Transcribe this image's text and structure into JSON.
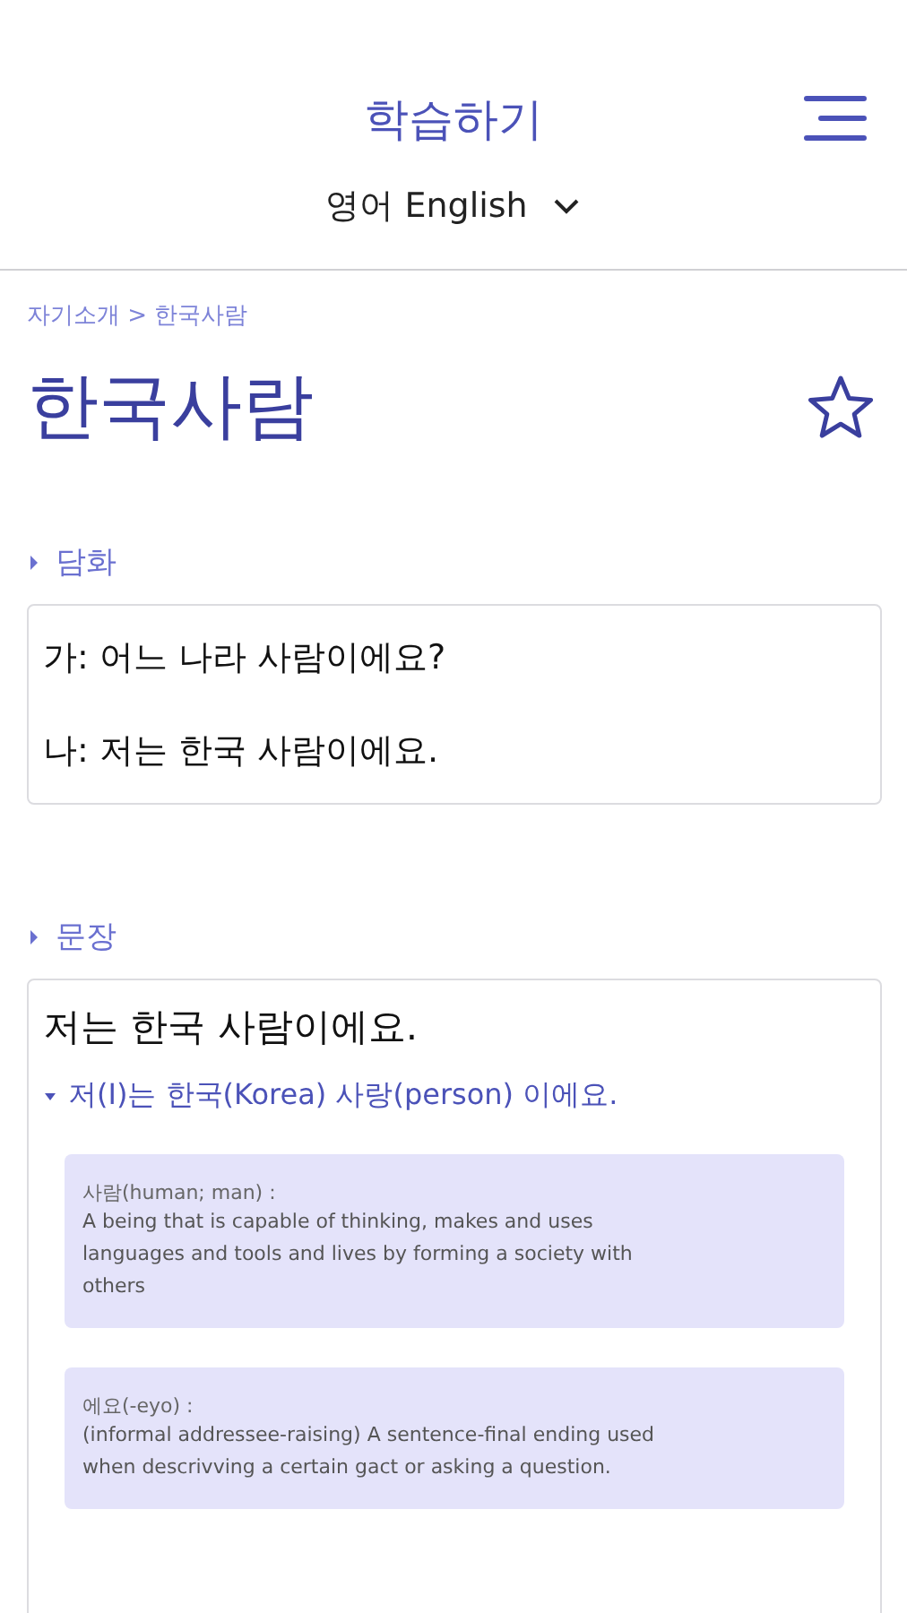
{
  "header": {
    "title": "학습하기",
    "language": "영어 English"
  },
  "breadcrumb": "자기소개 > 한국사람",
  "page": {
    "title": "한국사람",
    "favorite": false
  },
  "sections": [
    {
      "kind": "dialogue",
      "heading": "담화",
      "lines": [
        "가: 어느 나라 사람이에요?",
        "나: 저는 한국 사람이에요."
      ]
    },
    {
      "kind": "sentence",
      "heading": "문장",
      "sentence": "저는 한국 사람이에요.",
      "breakdown": {
        "text": "저(I)는 한국(Korea) 사랑(person) 이에요.",
        "expanded": true
      },
      "definitions": [
        {
          "term": "사람(human; man) :",
          "meaning": "A being that is capable of thinking, makes and uses languages and tools and lives by forming a society with others"
        },
        {
          "term": "에요(-eyo) :",
          "meaning": "(informal addressee-raising) A sentence-final ending used when descrivving a certain gact or asking a question."
        }
      ]
    }
  ]
}
